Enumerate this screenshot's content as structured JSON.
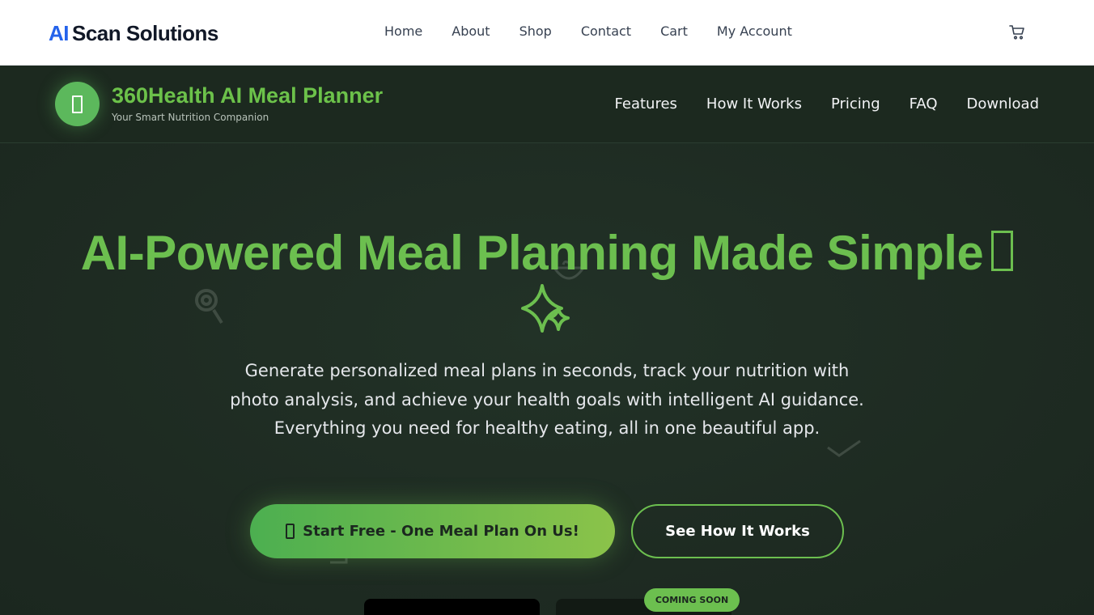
{
  "site": {
    "brand_prefix": "AI",
    "brand_name": "Scan Solutions",
    "nav": [
      "Home",
      "About",
      "Shop",
      "Contact",
      "Cart",
      "My Account"
    ],
    "cart_icon": "cart-icon"
  },
  "app": {
    "logo_icon": "phone-icon",
    "title": "360Health AI Meal Planner",
    "subtitle": "Your Smart Nutrition Companion",
    "nav": [
      "Features",
      "How It Works",
      "Pricing",
      "FAQ",
      "Download"
    ]
  },
  "hero": {
    "title": "AI-Powered Meal Planning Made Simple",
    "title_icon": "sparkle-icon",
    "description": "Generate personalized meal plans in seconds, track your nutrition with photo analysis, and achieve your health goals with intelligent AI guidance. Everything you need for healthy eating, all in one beautiful app.",
    "primary_button": "Start Free - One Meal Plan On Us!",
    "secondary_button": "See How It Works",
    "badge": "COMING SOON"
  },
  "colors": {
    "accent_green": "#6cbf4f",
    "brand_blue": "#2563eb",
    "dark_bg": "#1e2b22"
  }
}
